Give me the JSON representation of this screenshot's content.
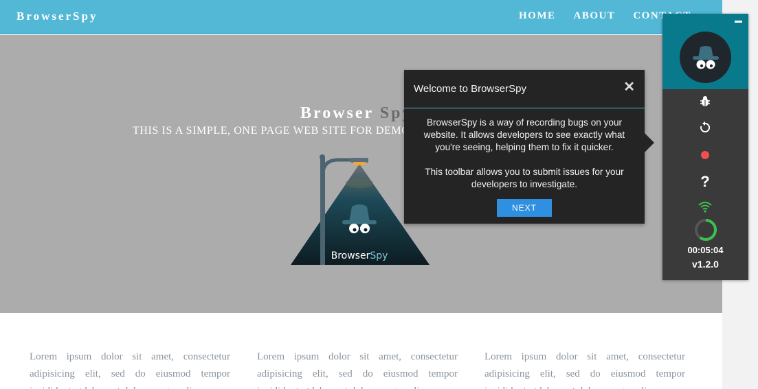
{
  "nav": {
    "brand": "BrowserSpy",
    "links": [
      "HOME",
      "ABOUT",
      "CONTACT"
    ]
  },
  "hero": {
    "title_part1": "Browser",
    "title_part2": "Spy",
    "subtitle": "THIS IS A SIMPLE, ONE PAGE WEB SITE FOR DEMO",
    "logo_text_1": "Browser",
    "logo_text_2": "Spy"
  },
  "features": {
    "columns": [
      "Lorem ipsum dolor sit amet, consectetur adipisicing elit, sed do eiusmod tempor incididunt ut labore et dolore magna aliqua.",
      "Lorem ipsum dolor sit amet, consectetur adipisicing elit, sed do eiusmod tempor incididunt ut labore et dolore magna aliqua.",
      "Lorem ipsum dolor sit amet, consectetur adipisicing elit, sed do eiusmod tempor incididunt ut labore et dolore magna aliqua."
    ]
  },
  "popup": {
    "title": "Welcome to BrowserSpy",
    "close": "✕",
    "paragraph1": "BrowserSpy is a way of recording bugs on your website. It allows developers to see exactly what you're seeing, helping them to fix it quicker.",
    "paragraph2": "This toolbar allows you to submit issues for your developers to investigate.",
    "next_label": "NEXT"
  },
  "toolbar": {
    "icons": [
      "spy-icon",
      "bug-icon",
      "refresh-icon",
      "record-icon",
      "help-icon",
      "wifi-icon",
      "progress-ring"
    ],
    "help": "?",
    "timer": "00:05:04",
    "version": "v1.2.0",
    "progress": 0.6
  },
  "colors": {
    "navbar": "#52b8d6",
    "hero": "#adacad",
    "toolbar_header": "#087a8c",
    "toolbar_body": "#3a3a3a",
    "record": "#f05050",
    "status_green": "#3cc04f",
    "next_button": "#2f8fe0"
  }
}
